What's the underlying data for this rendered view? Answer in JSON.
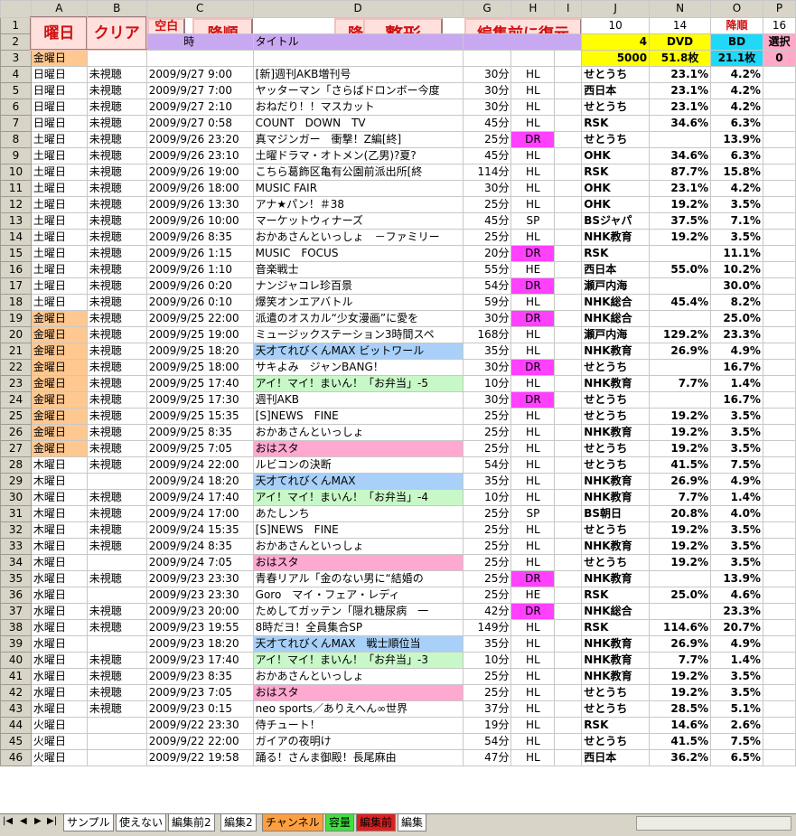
{
  "columns": [
    "",
    "A",
    "B",
    "C",
    "D",
    "G",
    "H",
    "I",
    "J",
    "N",
    "O",
    "P"
  ],
  "row1": {
    "j": "10",
    "n": "14",
    "o": "降順",
    "p": "16"
  },
  "buttons": {
    "youbi": "曜日",
    "clear": "クリア",
    "kuhaku": "空白削除",
    "kojun1": "降順",
    "kojun2": "降順",
    "seikei": "整形",
    "fukugen": "編集前に復元"
  },
  "row2": {
    "c_partial": "時",
    "d_title": "タイトル",
    "j": "4",
    "n": "DVD",
    "o": "BD",
    "p": "選択"
  },
  "row3": {
    "a": "金曜日",
    "j": "5000",
    "n": "51.8枚",
    "o": "21.1枚",
    "p": "0"
  },
  "rows": [
    {
      "n": "4",
      "a": "日曜日",
      "b": "未視聴",
      "c": "2009/9/27 9:00",
      "d": "[新]週刊AKB増刊号",
      "g": "30分",
      "h": "HL",
      "j": "せとうち",
      "nv": "23.1%",
      "ov": "4.2%",
      "ac": "",
      "dc": "",
      "hc": ""
    },
    {
      "n": "5",
      "a": "日曜日",
      "b": "未視聴",
      "c": "2009/9/27 7:00",
      "d": "ヤッターマン「さらばドロンボー今度",
      "g": "30分",
      "h": "HL",
      "j": "西日本",
      "nv": "23.1%",
      "ov": "4.2%",
      "ac": "",
      "dc": "",
      "hc": ""
    },
    {
      "n": "6",
      "a": "日曜日",
      "b": "未視聴",
      "c": "2009/9/27 2:10",
      "d": "おねだり！！マスカット",
      "g": "30分",
      "h": "HL",
      "j": "せとうち",
      "nv": "23.1%",
      "ov": "4.2%",
      "ac": "",
      "dc": "",
      "hc": ""
    },
    {
      "n": "7",
      "a": "日曜日",
      "b": "未視聴",
      "c": "2009/9/27 0:58",
      "d": "COUNT　DOWN　TV",
      "g": "45分",
      "h": "HL",
      "j": "RSK",
      "nv": "34.6%",
      "ov": "6.3%",
      "ac": "",
      "dc": "",
      "hc": ""
    },
    {
      "n": "8",
      "a": "土曜日",
      "b": "未視聴",
      "c": "2009/9/26 23:20",
      "d": "真マジンガー　衝撃！Z編[終]",
      "g": "25分",
      "h": "DR",
      "j": "せとうち",
      "nv": "",
      "ov": "13.9%",
      "ac": "",
      "dc": "",
      "hc": "magenta"
    },
    {
      "n": "9",
      "a": "土曜日",
      "b": "未視聴",
      "c": "2009/9/26 23:10",
      "d": "土曜ドラマ・オトメン(乙男)?夏?",
      "g": "45分",
      "h": "HL",
      "j": "OHK",
      "nv": "34.6%",
      "ov": "6.3%",
      "ac": "",
      "dc": "",
      "hc": ""
    },
    {
      "n": "10",
      "a": "土曜日",
      "b": "未視聴",
      "c": "2009/9/26 19:00",
      "d": "こちら葛飾区亀有公園前派出所[終",
      "g": "114分",
      "h": "HL",
      "j": "RSK",
      "nv": "87.7%",
      "ov": "15.8%",
      "ac": "",
      "dc": "",
      "hc": ""
    },
    {
      "n": "11",
      "a": "土曜日",
      "b": "未視聴",
      "c": "2009/9/26 18:00",
      "d": "MUSIC FAIR",
      "g": "30分",
      "h": "HL",
      "j": "OHK",
      "nv": "23.1%",
      "ov": "4.2%",
      "ac": "",
      "dc": "",
      "hc": ""
    },
    {
      "n": "12",
      "a": "土曜日",
      "b": "未視聴",
      "c": "2009/9/26 13:30",
      "d": "アナ★パン！＃38",
      "g": "25分",
      "h": "HL",
      "j": "OHK",
      "nv": "19.2%",
      "ov": "3.5%",
      "ac": "",
      "dc": "",
      "hc": ""
    },
    {
      "n": "13",
      "a": "土曜日",
      "b": "未視聴",
      "c": "2009/9/26 10:00",
      "d": "マーケットウィナーズ",
      "g": "45分",
      "h": "SP",
      "j": "BSジャパ",
      "nv": "37.5%",
      "ov": "7.1%",
      "ac": "",
      "dc": "",
      "hc": ""
    },
    {
      "n": "14",
      "a": "土曜日",
      "b": "未視聴",
      "c": "2009/9/26 8:35",
      "d": "おかあさんといっしょ　－ファミリー",
      "g": "25分",
      "h": "HL",
      "j": "NHK教育",
      "nv": "19.2%",
      "ov": "3.5%",
      "ac": "",
      "dc": "",
      "hc": ""
    },
    {
      "n": "15",
      "a": "土曜日",
      "b": "未視聴",
      "c": "2009/9/26 1:15",
      "d": "MUSIC　FOCUS",
      "g": "20分",
      "h": "DR",
      "j": "RSK",
      "nv": "",
      "ov": "11.1%",
      "ac": "",
      "dc": "",
      "hc": "magenta"
    },
    {
      "n": "16",
      "a": "土曜日",
      "b": "未視聴",
      "c": "2009/9/26 1:10",
      "d": "音楽戦士",
      "g": "55分",
      "h": "HE",
      "j": "西日本",
      "nv": "55.0%",
      "ov": "10.2%",
      "ac": "",
      "dc": "",
      "hc": ""
    },
    {
      "n": "17",
      "a": "土曜日",
      "b": "未視聴",
      "c": "2009/9/26 0:20",
      "d": "ナンジャコレ珍百景",
      "g": "54分",
      "h": "DR",
      "j": "瀬戸内海",
      "nv": "",
      "ov": "30.0%",
      "ac": "",
      "dc": "",
      "hc": "magenta"
    },
    {
      "n": "18",
      "a": "土曜日",
      "b": "未視聴",
      "c": "2009/9/26 0:10",
      "d": "爆笑オンエアバトル",
      "g": "59分",
      "h": "HL",
      "j": "NHK総合",
      "nv": "45.4%",
      "ov": "8.2%",
      "ac": "",
      "dc": "",
      "hc": ""
    },
    {
      "n": "19",
      "a": "金曜日",
      "b": "未視聴",
      "c": "2009/9/25 22:00",
      "d": "派遣のオスカル“少女漫画”に愛を",
      "g": "30分",
      "h": "DR",
      "j": "NHK総合",
      "nv": "",
      "ov": "25.0%",
      "ac": "orange",
      "dc": "",
      "hc": "magenta"
    },
    {
      "n": "20",
      "a": "金曜日",
      "b": "未視聴",
      "c": "2009/9/25 19:00",
      "d": "ミュージックステーション3時間スペ",
      "g": "168分",
      "h": "HL",
      "j": "瀬戸内海",
      "nv": "129.2%",
      "ov": "23.3%",
      "ac": "orange",
      "dc": "",
      "hc": ""
    },
    {
      "n": "21",
      "a": "金曜日",
      "b": "未視聴",
      "c": "2009/9/25 18:20",
      "d": "天才てれびくんMAX ビットワール",
      "g": "35分",
      "h": "HL",
      "j": "NHK教育",
      "nv": "26.9%",
      "ov": "4.9%",
      "ac": "orange",
      "dc": "blue",
      "hc": ""
    },
    {
      "n": "22",
      "a": "金曜日",
      "b": "未視聴",
      "c": "2009/9/25 18:00",
      "d": "サキよみ　ジャンBANG！",
      "g": "30分",
      "h": "DR",
      "j": "せとうち",
      "nv": "",
      "ov": "16.7%",
      "ac": "orange",
      "dc": "",
      "hc": "magenta"
    },
    {
      "n": "23",
      "a": "金曜日",
      "b": "未視聴",
      "c": "2009/9/25 17:40",
      "d": "アイ！マイ！まいん！「お弁当」-5",
      "g": "10分",
      "h": "HL",
      "j": "NHK教育",
      "nv": "7.7%",
      "ov": "1.4%",
      "ac": "orange",
      "dc": "green",
      "hc": ""
    },
    {
      "n": "24",
      "a": "金曜日",
      "b": "未視聴",
      "c": "2009/9/25 17:30",
      "d": "週刊AKB",
      "g": "30分",
      "h": "DR",
      "j": "せとうち",
      "nv": "",
      "ov": "16.7%",
      "ac": "orange",
      "dc": "",
      "hc": "magenta"
    },
    {
      "n": "25",
      "a": "金曜日",
      "b": "未視聴",
      "c": "2009/9/25 15:35",
      "d": "[S]NEWS　FINE",
      "g": "25分",
      "h": "HL",
      "j": "せとうち",
      "nv": "19.2%",
      "ov": "3.5%",
      "ac": "orange",
      "dc": "",
      "hc": ""
    },
    {
      "n": "26",
      "a": "金曜日",
      "b": "未視聴",
      "c": "2009/9/25 8:35",
      "d": "おかあさんといっしょ",
      "g": "25分",
      "h": "HL",
      "j": "NHK教育",
      "nv": "19.2%",
      "ov": "3.5%",
      "ac": "orange",
      "dc": "",
      "hc": ""
    },
    {
      "n": "27",
      "a": "金曜日",
      "b": "未視聴",
      "c": "2009/9/25 7:05",
      "d": "おはスタ",
      "g": "25分",
      "h": "HL",
      "j": "せとうち",
      "nv": "19.2%",
      "ov": "3.5%",
      "ac": "orange",
      "dc": "rose",
      "hc": ""
    },
    {
      "n": "28",
      "a": "木曜日",
      "b": "未視聴",
      "c": "2009/9/24 22:00",
      "d": "ルビコンの決断",
      "g": "54分",
      "h": "HL",
      "j": "せとうち",
      "nv": "41.5%",
      "ov": "7.5%",
      "ac": "",
      "dc": "",
      "hc": ""
    },
    {
      "n": "29",
      "a": "木曜日",
      "b": "",
      "c": "2009/9/24 18:20",
      "d": "天才てれびくんMAX",
      "g": "35分",
      "h": "HL",
      "j": "NHK教育",
      "nv": "26.9%",
      "ov": "4.9%",
      "ac": "",
      "dc": "blue",
      "hc": ""
    },
    {
      "n": "30",
      "a": "木曜日",
      "b": "未視聴",
      "c": "2009/9/24 17:40",
      "d": "アイ！マイ！まいん！「お弁当」-4",
      "g": "10分",
      "h": "HL",
      "j": "NHK教育",
      "nv": "7.7%",
      "ov": "1.4%",
      "ac": "",
      "dc": "green",
      "hc": ""
    },
    {
      "n": "31",
      "a": "木曜日",
      "b": "未視聴",
      "c": "2009/9/24 17:00",
      "d": "あたしンち",
      "g": "25分",
      "h": "SP",
      "j": "BS朝日",
      "nv": "20.8%",
      "ov": "4.0%",
      "ac": "",
      "dc": "",
      "hc": ""
    },
    {
      "n": "32",
      "a": "木曜日",
      "b": "未視聴",
      "c": "2009/9/24 15:35",
      "d": "[S]NEWS　FINE",
      "g": "25分",
      "h": "HL",
      "j": "せとうち",
      "nv": "19.2%",
      "ov": "3.5%",
      "ac": "",
      "dc": "",
      "hc": ""
    },
    {
      "n": "33",
      "a": "木曜日",
      "b": "未視聴",
      "c": "2009/9/24 8:35",
      "d": "おかあさんといっしょ",
      "g": "25分",
      "h": "HL",
      "j": "NHK教育",
      "nv": "19.2%",
      "ov": "3.5%",
      "ac": "",
      "dc": "",
      "hc": ""
    },
    {
      "n": "34",
      "a": "木曜日",
      "b": "",
      "c": "2009/9/24 7:05",
      "d": "おはスタ",
      "g": "25分",
      "h": "HL",
      "j": "せとうち",
      "nv": "19.2%",
      "ov": "3.5%",
      "ac": "",
      "dc": "rose",
      "hc": ""
    },
    {
      "n": "35",
      "a": "水曜日",
      "b": "未視聴",
      "c": "2009/9/23 23:30",
      "d": "青春リアル「金のない男に“結婚の",
      "g": "25分",
      "h": "DR",
      "j": "NHK教育",
      "nv": "",
      "ov": "13.9%",
      "ac": "",
      "dc": "",
      "hc": "magenta"
    },
    {
      "n": "36",
      "a": "水曜日",
      "b": "",
      "c": "2009/9/23 23:30",
      "d": "Goro　マイ・フェア・レディ",
      "g": "25分",
      "h": "HE",
      "j": "RSK",
      "nv": "25.0%",
      "ov": "4.6%",
      "ac": "",
      "dc": "",
      "hc": ""
    },
    {
      "n": "37",
      "a": "水曜日",
      "b": "未視聴",
      "c": "2009/9/23 20:00",
      "d": "ためしてガッテン「隠れ糖尿病　一",
      "g": "42分",
      "h": "DR",
      "j": "NHK総合",
      "nv": "",
      "ov": "23.3%",
      "ac": "",
      "dc": "",
      "hc": "magenta"
    },
    {
      "n": "38",
      "a": "水曜日",
      "b": "未視聴",
      "c": "2009/9/23 19:55",
      "d": "8時だヨ！全員集合SP",
      "g": "149分",
      "h": "HL",
      "j": "RSK",
      "nv": "114.6%",
      "ov": "20.7%",
      "ac": "",
      "dc": "",
      "hc": ""
    },
    {
      "n": "39",
      "a": "水曜日",
      "b": "",
      "c": "2009/9/23 18:20",
      "d": "天才てれびくんMAX　戦士順位当",
      "g": "35分",
      "h": "HL",
      "j": "NHK教育",
      "nv": "26.9%",
      "ov": "4.9%",
      "ac": "",
      "dc": "blue",
      "hc": ""
    },
    {
      "n": "40",
      "a": "水曜日",
      "b": "未視聴",
      "c": "2009/9/23 17:40",
      "d": "アイ！マイ！まいん！「お弁当」-3",
      "g": "10分",
      "h": "HL",
      "j": "NHK教育",
      "nv": "7.7%",
      "ov": "1.4%",
      "ac": "",
      "dc": "green",
      "hc": ""
    },
    {
      "n": "41",
      "a": "水曜日",
      "b": "未視聴",
      "c": "2009/9/23 8:35",
      "d": "おかあさんといっしょ",
      "g": "25分",
      "h": "HL",
      "j": "NHK教育",
      "nv": "19.2%",
      "ov": "3.5%",
      "ac": "",
      "dc": "",
      "hc": ""
    },
    {
      "n": "42",
      "a": "水曜日",
      "b": "未視聴",
      "c": "2009/9/23 7:05",
      "d": "おはスタ",
      "g": "25分",
      "h": "HL",
      "j": "せとうち",
      "nv": "19.2%",
      "ov": "3.5%",
      "ac": "",
      "dc": "rose",
      "hc": ""
    },
    {
      "n": "43",
      "a": "水曜日",
      "b": "未視聴",
      "c": "2009/9/23 0:15",
      "d": "neo sports／ありえへん∞世界",
      "g": "37分",
      "h": "HL",
      "j": "せとうち",
      "nv": "28.5%",
      "ov": "5.1%",
      "ac": "",
      "dc": "",
      "hc": ""
    },
    {
      "n": "44",
      "a": "火曜日",
      "b": "",
      "c": "2009/9/22 23:30",
      "d": "侍チュート！",
      "g": "19分",
      "h": "HL",
      "j": "RSK",
      "nv": "14.6%",
      "ov": "2.6%",
      "ac": "",
      "dc": "",
      "hc": ""
    },
    {
      "n": "45",
      "a": "火曜日",
      "b": "",
      "c": "2009/9/22 22:00",
      "d": "ガイアの夜明け",
      "g": "54分",
      "h": "HL",
      "j": "せとうち",
      "nv": "41.5%",
      "ov": "7.5%",
      "ac": "",
      "dc": "",
      "hc": ""
    },
    {
      "n": "46",
      "a": "火曜日",
      "b": "",
      "c": "2009/9/22 19:58",
      "d": "踊る！さんま御殿！長尾麻由",
      "g": "47分",
      "h": "HL",
      "j": "西日本",
      "nv": "36.2%",
      "ov": "6.5%",
      "ac": "",
      "dc": "",
      "hc": ""
    }
  ],
  "sheet_tabs": [
    {
      "label": "サンプル",
      "color": "#ffffff"
    },
    {
      "label": "使えない",
      "color": "#ffffff"
    },
    {
      "label": "編集前2",
      "color": "#ffffff"
    },
    {
      "label": "編集2",
      "color": "#ffffff"
    },
    {
      "label": "チャンネル",
      "color": "#ffa040"
    },
    {
      "label": "容量",
      "color": "#40e040"
    },
    {
      "label": "編集前",
      "color": "#e02020"
    },
    {
      "label": "編集",
      "color": "#ffffff"
    }
  ],
  "nav_arrows": [
    "|◀",
    "◀",
    "▶",
    "▶|"
  ]
}
